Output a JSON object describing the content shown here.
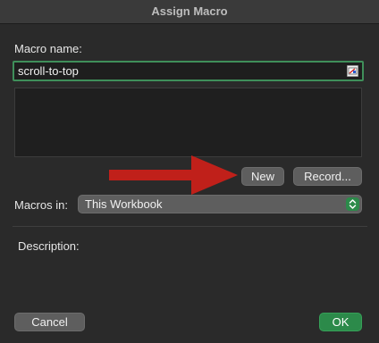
{
  "window": {
    "title": "Assign Macro"
  },
  "macro_name": {
    "label": "Macro name:",
    "value": "scroll-to-top",
    "field_icon": "contact-card-icon"
  },
  "buttons": {
    "new": "New",
    "record": "Record...",
    "cancel": "Cancel",
    "ok": "OK"
  },
  "macros_in": {
    "label": "Macros in:",
    "selected": "This Workbook",
    "icon": "chevron-up-down-icon"
  },
  "description": {
    "label": "Description:"
  },
  "annotation": {
    "icon": "red-arrow-icon",
    "color": "#c0201a"
  },
  "colors": {
    "accent": "#2c8a4a",
    "focus_ring": "#3f8f5a"
  }
}
